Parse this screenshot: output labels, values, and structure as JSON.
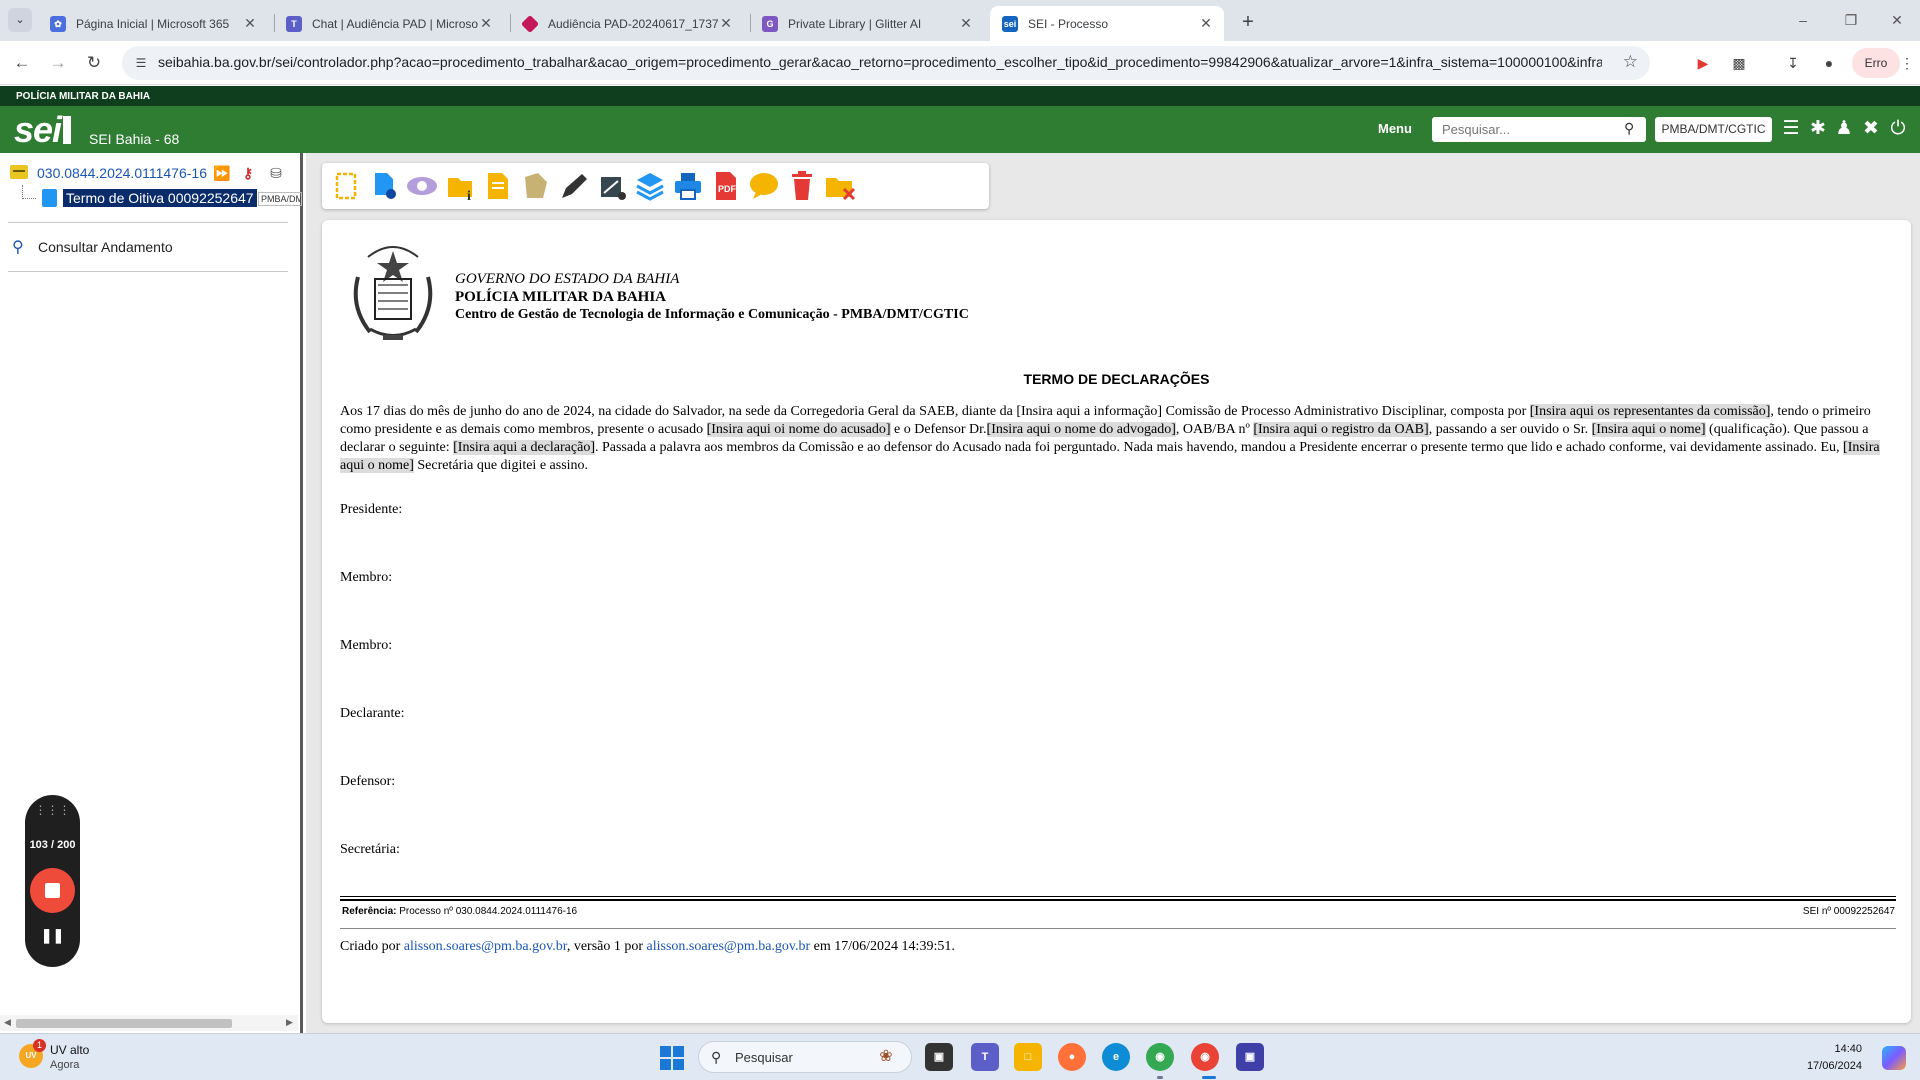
{
  "browser": {
    "tabs": [
      {
        "label": "Página Inicial | Microsoft 365",
        "active": false,
        "icon": "microsoft365-icon"
      },
      {
        "label": "Chat | Audiência PAD | Microsoft Teams",
        "active": false,
        "icon": "teams-icon"
      },
      {
        "label": "Audiência PAD-20240617_1737",
        "active": false,
        "icon": "stream-icon"
      },
      {
        "label": "Private Library | Glitter AI",
        "active": false,
        "icon": "glitter-icon"
      },
      {
        "label": "SEI - Processo",
        "active": true,
        "icon": "sei-icon"
      }
    ],
    "sei_favicon_text": "sei",
    "url": "seibahia.ba.gov.br/sei/controlador.php?acao=procedimento_trabalhar&acao_origem=procedimento_gerar&acao_retorno=procedimento_escolher_tipo&id_procedimento=99842906&atualizar_arvore=1&infra_sistema=100000100&infra_u...",
    "profile_status": "Erro"
  },
  "sei": {
    "org_banner": "POLÍCIA MILITAR DA BAHIA",
    "logo_text": "sei",
    "system_name": "SEI Bahia - 68",
    "menu_label": "Menu",
    "search_placeholder": "Pesquisar...",
    "unit": "PMBA/DMT/CGTIC"
  },
  "tree": {
    "process_number": "030.0844.2024.0111476-16",
    "document_label": "Termo de Oitiva 00092252647",
    "document_unit": "PMBA/DMT/CGTIC",
    "consult_label": "Consultar Andamento"
  },
  "recorder": {
    "count": "103 / 200"
  },
  "toolbar_icons": [
    "new-document-icon",
    "document-settings-icon",
    "view-icon",
    "document-info-icon",
    "edit-document-icon",
    "sign-block-icon",
    "signature-pen-icon",
    "authenticate-icon",
    "layers-icon",
    "print-icon",
    "pdf-icon",
    "comment-icon",
    "delete-icon",
    "cancel-document-icon"
  ],
  "document": {
    "header_line1": "GOVERNO DO ESTADO DA BAHIA",
    "header_line2": "POLÍCIA MILITAR DA BAHIA",
    "header_line3": "Centro de Gestão de Tecnologia de Informação e Comunicação - PMBA/DMT/CGTIC",
    "title": "TERMO DE DECLARAÇÕES",
    "body": {
      "t1": "Aos 17 dias do mês de junho do ano de 2024, na cidade do Salvador, na sede da Corregedoria Geral da SAEB, diante da [Insira aqui a informação] Comissão de Processo Administrativo Disciplinar, composta por ",
      "p1": "[Insira aqui os representantes da comissão]",
      "t2": ", tendo o primeiro como presidente e as demais como membros, presente o acusado ",
      "p2": "[Insira aqui oi nome do acusado]",
      "t3": " e o Defensor Dr.",
      "p3": "[Insira aqui o nome do advogado]",
      "t4": ", OAB/BA nº ",
      "p4": "[Insira aqui o registro da OAB]",
      "t5": ", passando a ser ouvido o Sr. ",
      "p5": "[Insira aqui o nome]",
      "t6": " (qualificação). Que passou a declarar o seguinte: ",
      "p6": "[Insira aqui a declaração]",
      "t7": ". Passada a palavra aos membros da Comissão e ao defensor do Acusado nada foi perguntado. Nada mais havendo, mandou a Presidente encerrar o presente termo que lido e achado conforme, vai devidamente assinado. Eu, ",
      "p7": "[Insira aqui o nome]",
      "t8": " Secretária que digitei e assino."
    },
    "signatures": [
      "Presidente:",
      "Membro:",
      "Membro:",
      "Declarante:",
      "Defensor:",
      "Secretária:"
    ],
    "reference_label": "Referência:",
    "reference_text": "Processo nº 030.0844.2024.0111476-16",
    "sei_number": "SEI nº 00092252647",
    "created": {
      "prefix": "Criado por ",
      "creator": "alisson.soares@pm.ba.gov.br",
      "middle": ", versão 1 por ",
      "editor": "alisson.soares@pm.ba.gov.br",
      "suffix": " em 17/06/2024 14:39:51."
    }
  },
  "taskbar": {
    "weather_title": "UV alto",
    "weather_sub": "Agora",
    "weather_badge": "1",
    "weather_icon_text": "UV",
    "search_label": "Pesquisar",
    "time": "14:40",
    "date": "17/06/2024"
  }
}
